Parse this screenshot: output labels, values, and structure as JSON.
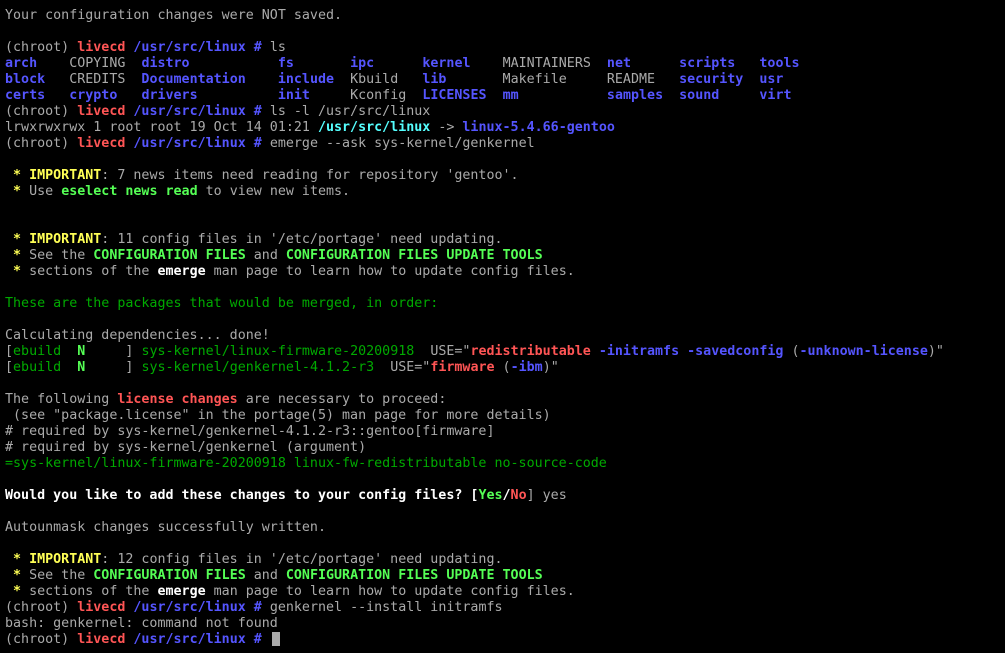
{
  "terminal": {
    "colors": {
      "background": "#000000",
      "default": "#aaaaaa",
      "red": "#ff5555",
      "blue": "#5555ff",
      "green": "#55ff55",
      "dark_green": "#00aa00",
      "yellow": "#ffff55",
      "white": "#ffffff",
      "cyan": "#55ffff"
    },
    "lines": [
      [
        [
          "Your configuration changes were NOT saved.",
          "grey"
        ]
      ],
      [],
      [
        [
          "(chroot) ",
          "grey"
        ],
        [
          "livecd",
          "red"
        ],
        [
          " /usr/src/linux #",
          "blue"
        ],
        [
          " ls",
          "grey"
        ]
      ],
      [
        [
          "arch",
          "blue"
        ],
        [
          "    COPYING  ",
          "grey"
        ],
        [
          "distro",
          "blue"
        ],
        [
          "           ",
          "grey"
        ],
        [
          "fs",
          "blue"
        ],
        [
          "       ",
          "grey"
        ],
        [
          "ipc",
          "blue"
        ],
        [
          "      ",
          "grey"
        ],
        [
          "kernel",
          "blue"
        ],
        [
          "    MAINTAINERS  ",
          "grey"
        ],
        [
          "net",
          "blue"
        ],
        [
          "      ",
          "grey"
        ],
        [
          "scripts",
          "blue"
        ],
        [
          "   ",
          "grey"
        ],
        [
          "tools",
          "blue"
        ]
      ],
      [
        [
          "block",
          "blue"
        ],
        [
          "   CREDITS  ",
          "grey"
        ],
        [
          "Documentation",
          "blue"
        ],
        [
          "    ",
          "grey"
        ],
        [
          "include",
          "blue"
        ],
        [
          "  Kbuild   ",
          "grey"
        ],
        [
          "lib",
          "blue"
        ],
        [
          "       Makefile     README   ",
          "grey"
        ],
        [
          "security",
          "blue"
        ],
        [
          "  ",
          "grey"
        ],
        [
          "usr",
          "blue"
        ]
      ],
      [
        [
          "certs",
          "blue"
        ],
        [
          "   ",
          "grey"
        ],
        [
          "crypto",
          "blue"
        ],
        [
          "   ",
          "grey"
        ],
        [
          "drivers",
          "blue"
        ],
        [
          "          ",
          "grey"
        ],
        [
          "init",
          "blue"
        ],
        [
          "     Kconfig  ",
          "grey"
        ],
        [
          "LICENSES",
          "blue"
        ],
        [
          "  ",
          "grey"
        ],
        [
          "mm",
          "blue"
        ],
        [
          "           ",
          "grey"
        ],
        [
          "samples",
          "blue"
        ],
        [
          "  ",
          "grey"
        ],
        [
          "sound",
          "blue"
        ],
        [
          "     ",
          "grey"
        ],
        [
          "virt",
          "blue"
        ]
      ],
      [
        [
          "(chroot) ",
          "grey"
        ],
        [
          "livecd",
          "red"
        ],
        [
          " /usr/src/linux #",
          "blue"
        ],
        [
          " ls -l /usr/src/linux",
          "grey"
        ]
      ],
      [
        [
          "lrwxrwxrwx 1 root root 19 Oct 14 01:21 ",
          "grey"
        ],
        [
          "/usr/src/linux",
          "cyan"
        ],
        [
          " -> ",
          "grey"
        ],
        [
          "linux-5.4.66-gentoo",
          "blue"
        ]
      ],
      [
        [
          "(chroot) ",
          "grey"
        ],
        [
          "livecd",
          "red"
        ],
        [
          " /usr/src/linux #",
          "blue"
        ],
        [
          " emerge --ask sys-kernel/genkernel",
          "grey"
        ]
      ],
      [],
      [
        [
          " * ",
          "yellow"
        ],
        [
          "IMPORTANT",
          "yellow"
        ],
        [
          ": 7 news items need reading for repository 'gentoo'.",
          "grey"
        ]
      ],
      [
        [
          " * ",
          "yellow"
        ],
        [
          "Use ",
          "grey"
        ],
        [
          "eselect news read",
          "green"
        ],
        [
          " to view new items.",
          "grey"
        ]
      ],
      [],
      [],
      [
        [
          " * ",
          "yellow"
        ],
        [
          "IMPORTANT",
          "yellow"
        ],
        [
          ": 11 config files in '/etc/portage' need updating.",
          "grey"
        ]
      ],
      [
        [
          " * ",
          "yellow"
        ],
        [
          "See the ",
          "grey"
        ],
        [
          "CONFIGURATION FILES",
          "green"
        ],
        [
          " and ",
          "grey"
        ],
        [
          "CONFIGURATION FILES UPDATE TOOLS",
          "green"
        ]
      ],
      [
        [
          " * ",
          "yellow"
        ],
        [
          "sections of the ",
          "grey"
        ],
        [
          "emerge",
          "white"
        ],
        [
          " man page to learn how to update config files.",
          "grey"
        ]
      ],
      [],
      [
        [
          "These are the packages that would be merged, in order:",
          "dark_green"
        ]
      ],
      [],
      [
        [
          "Calculating dependencies... done!",
          "grey"
        ]
      ],
      [
        [
          "[",
          "grey"
        ],
        [
          "ebuild",
          "dark_green"
        ],
        [
          "  ",
          "grey"
        ],
        [
          "N",
          "green"
        ],
        [
          "     ] ",
          "grey"
        ],
        [
          "sys-kernel/linux-firmware-20200918",
          "dark_green"
        ],
        [
          "  USE=\"",
          "grey"
        ],
        [
          "redistributable",
          "red"
        ],
        [
          " ",
          "grey"
        ],
        [
          "-initramfs -savedconfig",
          "blue"
        ],
        [
          " (",
          "grey"
        ],
        [
          "-unknown-license",
          "blue"
        ],
        [
          ")\"",
          "grey"
        ]
      ],
      [
        [
          "[",
          "grey"
        ],
        [
          "ebuild",
          "dark_green"
        ],
        [
          "  ",
          "grey"
        ],
        [
          "N",
          "green"
        ],
        [
          "     ] ",
          "grey"
        ],
        [
          "sys-kernel/genkernel-4.1.2-r3",
          "dark_green"
        ],
        [
          "  USE=\"",
          "grey"
        ],
        [
          "firmware",
          "red"
        ],
        [
          " (",
          "grey"
        ],
        [
          "-ibm",
          "blue"
        ],
        [
          ")\"",
          "grey"
        ]
      ],
      [],
      [
        [
          "The following ",
          "grey"
        ],
        [
          "license changes",
          "red"
        ],
        [
          " are necessary to proceed:",
          "grey"
        ]
      ],
      [
        [
          " (see \"package.license\" in the portage(5) man page for more details)",
          "grey"
        ]
      ],
      [
        [
          "# required by sys-kernel/genkernel-4.1.2-r3::gentoo[firmware]",
          "grey"
        ]
      ],
      [
        [
          "# required by sys-kernel/genkernel (argument)",
          "grey"
        ]
      ],
      [
        [
          "=sys-kernel/linux-firmware-20200918 linux-fw-redistributable no-source-code",
          "dark_green"
        ]
      ],
      [],
      [
        [
          "Would you like to add these changes to your config files? [",
          "white"
        ],
        [
          "Yes",
          "green"
        ],
        [
          "/",
          "white"
        ],
        [
          "No",
          "red"
        ],
        [
          "] yes",
          "grey"
        ]
      ],
      [],
      [
        [
          "Autounmask changes successfully written.",
          "grey"
        ]
      ],
      [],
      [
        [
          " * ",
          "yellow"
        ],
        [
          "IMPORTANT",
          "yellow"
        ],
        [
          ": 12 config files in '/etc/portage' need updating.",
          "grey"
        ]
      ],
      [
        [
          " * ",
          "yellow"
        ],
        [
          "See the ",
          "grey"
        ],
        [
          "CONFIGURATION FILES",
          "green"
        ],
        [
          " and ",
          "grey"
        ],
        [
          "CONFIGURATION FILES UPDATE TOOLS",
          "green"
        ]
      ],
      [
        [
          " * ",
          "yellow"
        ],
        [
          "sections of the ",
          "grey"
        ],
        [
          "emerge",
          "white"
        ],
        [
          " man page to learn how to update config files.",
          "grey"
        ]
      ],
      [
        [
          "(chroot) ",
          "grey"
        ],
        [
          "livecd",
          "red"
        ],
        [
          " /usr/src/linux #",
          "blue"
        ],
        [
          " genkernel --install initramfs",
          "grey"
        ]
      ],
      [
        [
          "bash: genkernel: command not found",
          "grey"
        ]
      ],
      [
        [
          "(chroot) ",
          "grey"
        ],
        [
          "livecd",
          "red"
        ],
        [
          " /usr/src/linux #",
          "blue"
        ],
        [
          " ",
          "grey"
        ]
      ]
    ]
  }
}
